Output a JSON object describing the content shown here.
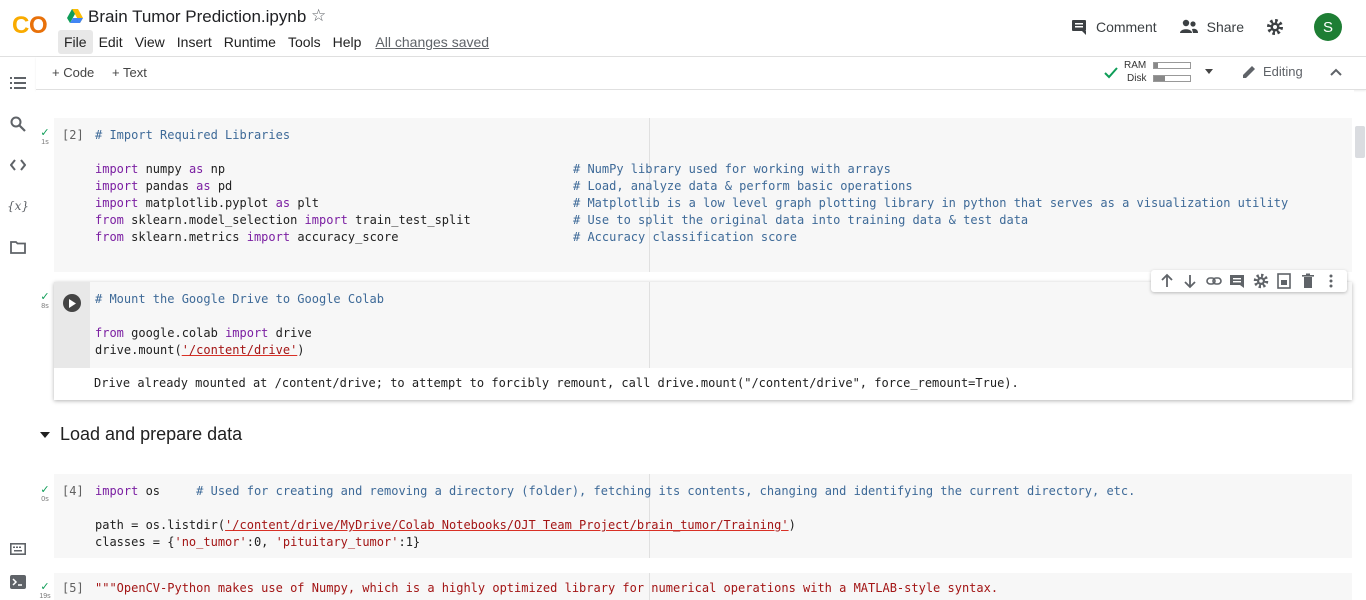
{
  "app": {
    "title": "Brain Tumor Prediction.ipynb",
    "logo_text": "CO",
    "menu": [
      "File",
      "Edit",
      "View",
      "Insert",
      "Runtime",
      "Tools",
      "Help"
    ],
    "saved_status": "All changes saved",
    "comment_label": "Comment",
    "share_label": "Share",
    "avatar_letter": "S"
  },
  "toolbar": {
    "code_label": "+ Code",
    "text_label": "+ Text",
    "ram_label": "RAM",
    "disk_label": "Disk",
    "ram_fraction": 0.12,
    "disk_fraction": 0.3,
    "editing_label": "Editing"
  },
  "cells": {
    "c1": {
      "count": "[2]",
      "time": "1s",
      "lines": [
        "# Import Required Libraries",
        "import numpy as np",
        "import pandas as pd",
        "import matplotlib.pyplot as plt",
        "from sklearn.model_selection import train_test_split",
        "from sklearn.metrics import accuracy_score"
      ],
      "comments": [
        "# NumPy library used for working with arrays",
        "# Load, analyze data & perform basic operations",
        "# Matplotlib is a low level graph plotting library in python that serves as a visualization utility",
        "# Use to split the original data into training data & test data",
        "# Accuracy classification score"
      ]
    },
    "c2": {
      "time": "8s",
      "line1": "# Mount the Google Drive to Google Colab",
      "line2_a": "from",
      "line2_b": " google.colab ",
      "line2_c": "import",
      "line2_d": " drive",
      "line3_a": "drive.mount(",
      "line3_b": "'/content/drive'",
      "line3_c": ")",
      "output": "Drive already mounted at /content/drive; to attempt to forcibly remount, call drive.mount(\"/content/drive\", force_remount=True)."
    },
    "section": "Load and prepare data",
    "c3": {
      "count": "[4]",
      "time": "0s",
      "l1_a": "import",
      "l1_b": " os     ",
      "l1_c": "# Used for creating and removing a directory (folder), fetching its contents, changing and identifying the current directory, etc.",
      "l2_a": "path = os.listdir(",
      "l2_b": "'/content/drive/MyDrive/Colab Notebooks/OJT Team Project/brain_tumor/Training'",
      "l2_c": ")",
      "l3_a": "classes = {",
      "l3_b": "'no_tumor'",
      "l3_c": ":0, ",
      "l3_d": "'pituitary_tumor'",
      "l3_e": ":1}"
    },
    "c4": {
      "count": "[5]",
      "time": "19s",
      "line1": "\"\"\"OpenCV-Python makes use of Numpy, which is a highly optimized library for numerical operations with a MATLAB-style syntax."
    }
  }
}
